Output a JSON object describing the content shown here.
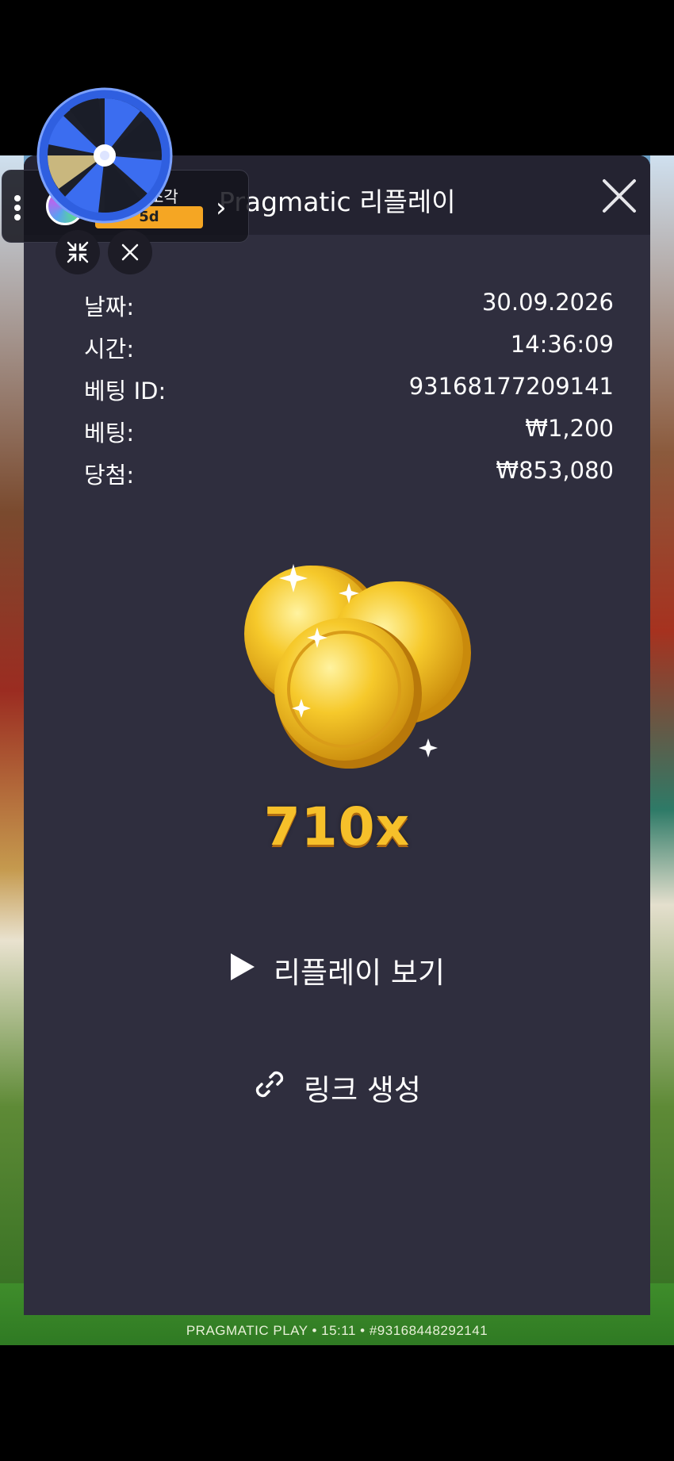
{
  "panel": {
    "title": "Pragmatic 리플레이",
    "rows": [
      {
        "label": "날짜:",
        "value": "30.09.2026"
      },
      {
        "label": "시간:",
        "value": "14:36:09"
      },
      {
        "label": "베팅 ID:",
        "value": "93168177209141"
      },
      {
        "label": "베팅:",
        "value": "₩1,200"
      },
      {
        "label": "당첨:",
        "value": "₩853,080"
      }
    ],
    "multiplier": "710x",
    "replay_label": "리플레이 보기",
    "link_label": "링크 생성"
  },
  "footer_text": "PRAGMATIC PLAY • 15:11 • #93168448292141",
  "overlay": {
    "badge": "5d",
    "partial_text": "조각"
  },
  "colors": {
    "panel_bg": "#2f2e3e",
    "header_bg": "#242331",
    "multiplier": "#f6c02a",
    "badge": "#f5a623",
    "wheel_blue": "#2f5fe0"
  }
}
